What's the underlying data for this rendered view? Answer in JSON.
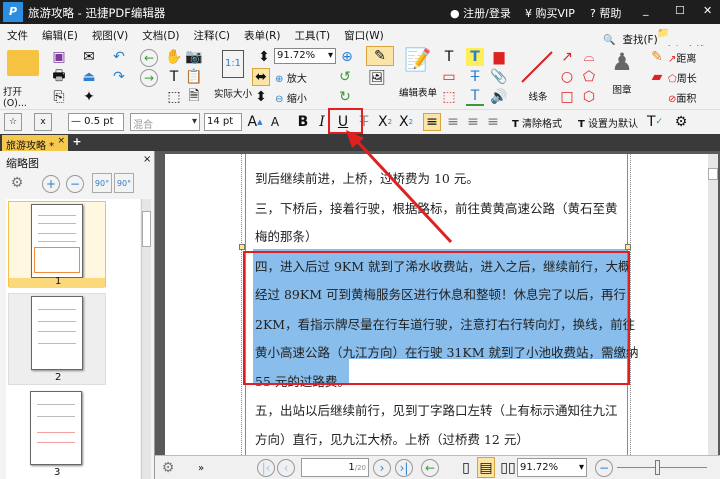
{
  "window": {
    "title": "旅游攻略 - 迅捷PDF编辑器",
    "login": "注册/登录",
    "vip": "购买VIP",
    "help": "帮助",
    "minimize": "_",
    "maximize": "☐",
    "close": "✕"
  },
  "menu": {
    "items": [
      "文件",
      "编辑(E)",
      "视图(V)",
      "文档(D)",
      "注释(C)",
      "表单(R)",
      "工具(T)",
      "窗口(W)"
    ],
    "find": "查找(F)",
    "advanced_find": "高级查找(S)"
  },
  "toolbar": {
    "open": "打开(O)...",
    "zoom_value": "91.72%",
    "actual_size": "实际大小",
    "zoom_in": "放大",
    "zoom_out": "缩小",
    "edit_form": "编辑表单",
    "lines": "线条",
    "stamp": "图章",
    "distance": "距离",
    "perimeter": "周长",
    "area": "面积"
  },
  "format": {
    "stroke": "— 0.5 pt",
    "font": "混合",
    "size": "14 pt",
    "clear_format": "清除格式",
    "set_default": "设置为默认"
  },
  "tabs": [
    {
      "label": "旅游攻略 *"
    }
  ],
  "thumbnails": {
    "title": "缩略图",
    "pages": [
      "1",
      "2",
      "3"
    ]
  },
  "document": {
    "lines": [
      "到后继续前进，上桥，过桥费为 10 元。",
      "三，下桥后，接着行驶，根据路标，前往黄黄高速公路（黄石至黄",
      "梅的那条）",
      "四，进入后过 9KM 就到了浠水收费站，进入之后，继续前行，大概",
      "经过 89KM 可到黄梅服务区进行休息和整顿！休息完了以后，再行",
      "2KM，看指示牌尽量在行车道行驶，注意打右行转向灯，换线，前往",
      "黄小高速公路（九江方向）在行驶 31KM 就到了小池收费站，需缴纳",
      "55 元的过路费。",
      "五，出站以后继续前行，见到丁字路口左转（上有标示通知往九江",
      "方向）直行，见九江大桥。上桥（过桥费 12 元）"
    ]
  },
  "nav": {
    "current_page": "1",
    "total_pages": "/20",
    "zoom": "91.72%"
  },
  "colors": {
    "highlight": "#e02020",
    "selection": "#88bdec",
    "tab": "#f6c850"
  }
}
